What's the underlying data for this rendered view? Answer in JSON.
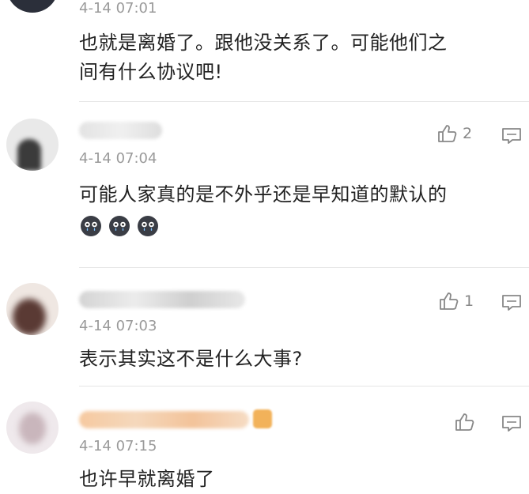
{
  "comments": [
    {
      "time": "4-14 07:01",
      "text_lines": [
        "也就是离婚了。跟他没关系了。可能他们之",
        "间有什么协议吧!"
      ],
      "likes": "",
      "emoji_count": 0
    },
    {
      "time": "4-14 07:04",
      "text_lines": [
        "可能人家真的是不外乎还是早知道的默认的"
      ],
      "likes": "2",
      "emoji_count": 3,
      "emoji": "crying-face-icon"
    },
    {
      "time": "4-14 07:03",
      "text_lines": [
        "表示其实这不是什么大事?"
      ],
      "likes": "1",
      "emoji_count": 0
    },
    {
      "time": "4-14 07:15",
      "text_lines": [
        "也许早就离婚了"
      ],
      "likes": "",
      "emoji_count": 0,
      "name_badge": "medal-icon"
    }
  ],
  "icons": {
    "like": "thumbs-up-icon",
    "reply": "comment-icon"
  },
  "colors": {
    "time": "#9a9a9a",
    "icon": "#888888",
    "text": "#222222",
    "divider": "#e6e6e6"
  }
}
